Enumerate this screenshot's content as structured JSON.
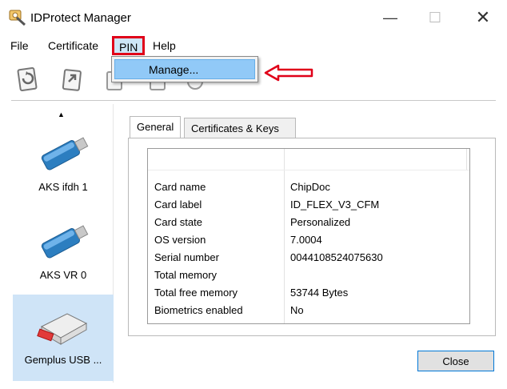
{
  "window": {
    "title": "IDProtect Manager"
  },
  "menu": {
    "file": "File",
    "certificate": "Certificate",
    "pin": "PIN",
    "help": "Help"
  },
  "pin_menu": {
    "manage": "Manage..."
  },
  "devices": [
    {
      "label": "AKS ifdh 1",
      "icon": "usb-token-icon"
    },
    {
      "label": "AKS VR 0",
      "icon": "usb-token-icon"
    },
    {
      "label": "Gemplus USB ...",
      "icon": "card-reader-icon"
    }
  ],
  "tabs": {
    "general": "General",
    "certs_keys": "Certificates & Keys"
  },
  "properties": [
    {
      "key": "Card name",
      "value": "ChipDoc"
    },
    {
      "key": "Card label",
      "value": "ID_FLEX_V3_CFM"
    },
    {
      "key": "Card state",
      "value": "Personalized"
    },
    {
      "key": "OS version",
      "value": "7.0004"
    },
    {
      "key": "Serial number",
      "value": "0044108524075630"
    },
    {
      "key": "Total memory",
      "value": ""
    },
    {
      "key": "Total free memory",
      "value": "53744 Bytes"
    },
    {
      "key": "Biometrics enabled",
      "value": "No"
    }
  ],
  "buttons": {
    "close": "Close"
  },
  "colors": {
    "highlight": "#e00019",
    "selection": "#91c9f7",
    "accent": "#0078d7"
  }
}
